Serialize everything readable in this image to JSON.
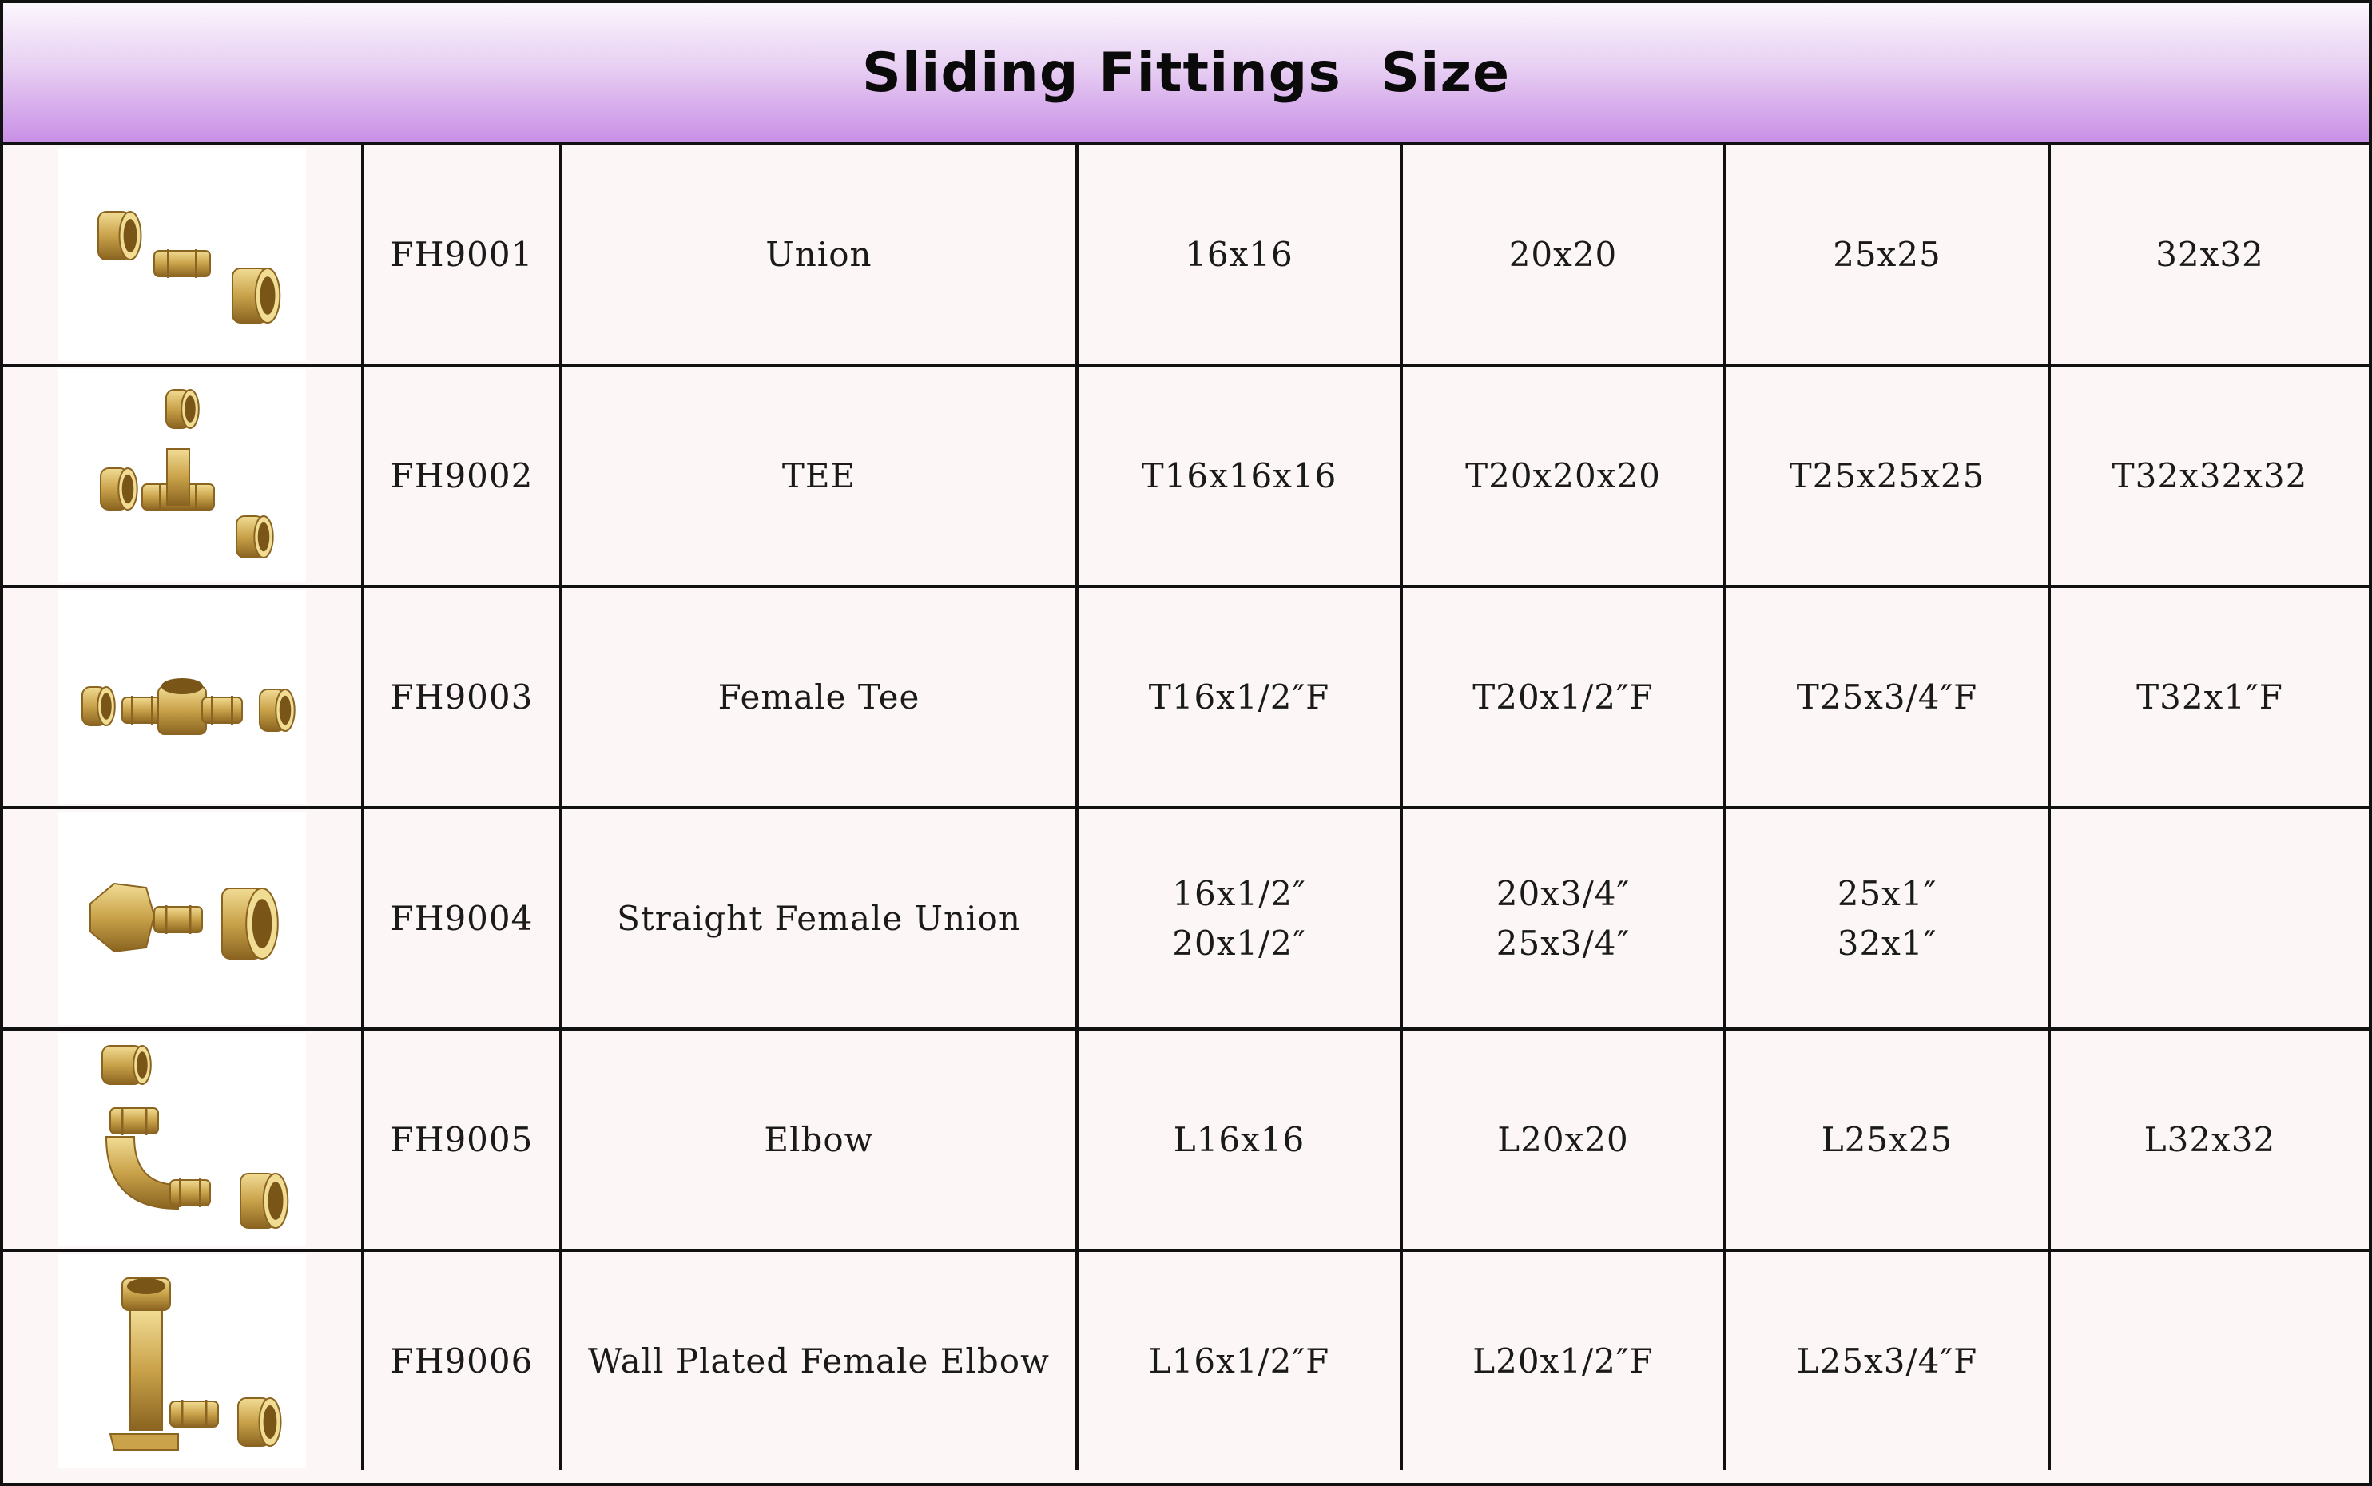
{
  "title": "Sliding Fittings  Size",
  "colors": {
    "header_top": "#fbf7fd",
    "header_bottom": "#c98fe6",
    "cell_bg": "#fcf6f6",
    "border": "#111111",
    "brass": "#c9a24a"
  },
  "rows": [
    {
      "image": "union-fitting-image",
      "code": "FH9001",
      "name": "Union",
      "sizes": [
        [
          "16x16"
        ],
        [
          "20x20"
        ],
        [
          "25x25"
        ],
        [
          "32x32"
        ]
      ]
    },
    {
      "image": "tee-fitting-image",
      "code": "FH9002",
      "name": "TEE",
      "sizes": [
        [
          "T16x16x16"
        ],
        [
          "T20x20x20"
        ],
        [
          "T25x25x25"
        ],
        [
          "T32x32x32"
        ]
      ]
    },
    {
      "image": "female-tee-fitting-image",
      "code": "FH9003",
      "name": "Female Tee",
      "sizes": [
        [
          "T16x1/2″F"
        ],
        [
          "T20x1/2″F"
        ],
        [
          "T25x3/4″F"
        ],
        [
          "T32x1″F"
        ]
      ]
    },
    {
      "image": "straight-female-union-image",
      "code": "FH9004",
      "name": "Straight Female Union",
      "sizes": [
        [
          "16x1/2″",
          "20x1/2″"
        ],
        [
          "20x3/4″",
          "25x3/4″"
        ],
        [
          "25x1″",
          "32x1″"
        ],
        []
      ]
    },
    {
      "image": "elbow-fitting-image",
      "code": "FH9005",
      "name": "Elbow",
      "sizes": [
        [
          "L16x16"
        ],
        [
          "L20x20"
        ],
        [
          "L25x25"
        ],
        [
          "L32x32"
        ]
      ]
    },
    {
      "image": "wall-plated-female-elbow-image",
      "code": "FH9006",
      "name": "Wall Plated Female Elbow",
      "sizes": [
        [
          "L16x1/2″F"
        ],
        [
          "L20x1/2″F"
        ],
        [
          "L25x3/4″F"
        ],
        []
      ]
    }
  ]
}
